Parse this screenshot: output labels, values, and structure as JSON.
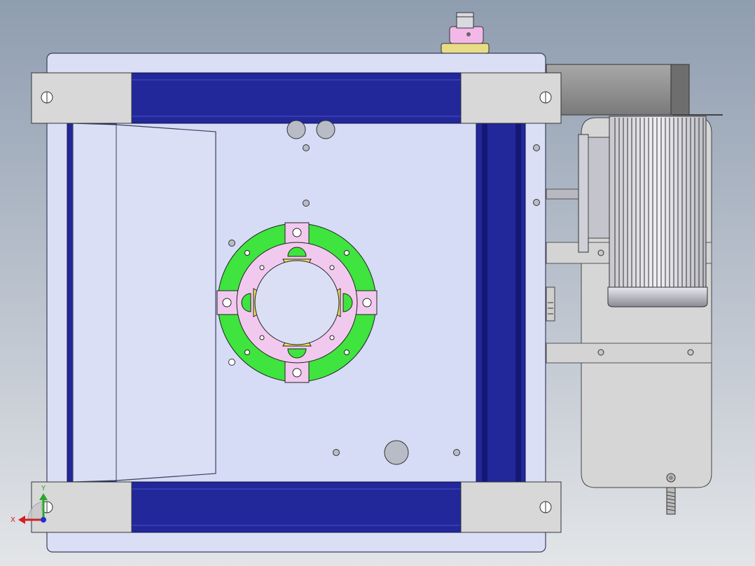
{
  "viewport": {
    "background_top": "#8f9db0",
    "background_bottom": "#e3e5e8"
  },
  "colors": {
    "frame_plate": "#dadff6",
    "frame_outline": "#3a3f5c",
    "beam_blue": "#22279a",
    "beam_blue_dark": "#141874",
    "bracket_grey": "#d8d8d8",
    "ring_green": "#3fe43f",
    "ring_pink": "#f2c9ee",
    "motor_grey": "#d3d3d3",
    "motor_dark": "#8c8c8c",
    "hole_grey": "#b8bcc6",
    "knob_pink": "#f4b8e8",
    "knob_yellow": "#e8dc86"
  },
  "coordinate_triad": {
    "y_label": "Y",
    "x_label": "X",
    "y_color": "#2aa82a",
    "x_color": "#d42020",
    "z_color": "#2030d8"
  }
}
